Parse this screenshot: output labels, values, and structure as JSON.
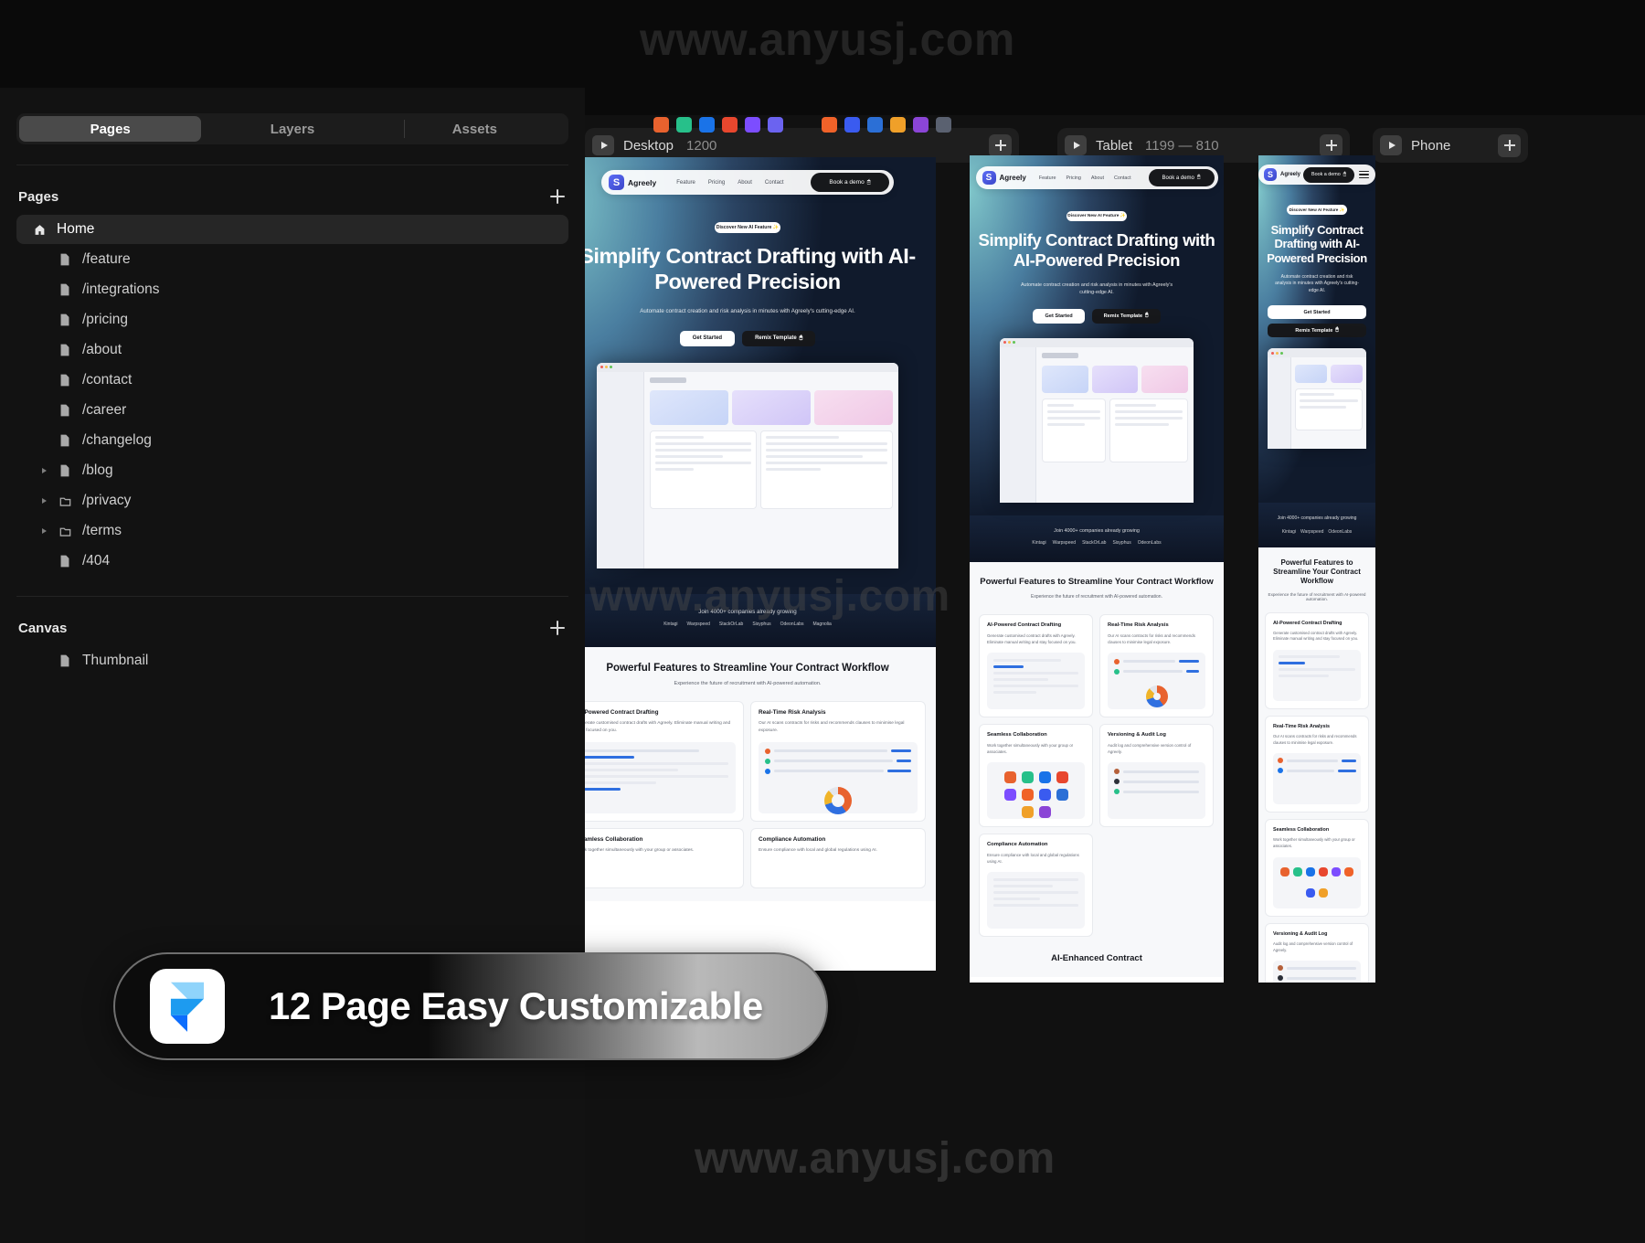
{
  "watermark": {
    "text": "www.anyusj.com"
  },
  "sidebar": {
    "tabs": [
      {
        "label": "Pages",
        "active": true
      },
      {
        "label": "Layers",
        "active": false
      },
      {
        "label": "Assets",
        "active": false
      }
    ],
    "pages_section": {
      "title": "Pages",
      "add_label": "+"
    },
    "pages": [
      {
        "label": "Home",
        "icon": "home-icon",
        "active": true,
        "expandable": false
      },
      {
        "label": "/feature",
        "icon": "page-icon",
        "active": false,
        "expandable": false
      },
      {
        "label": "/integrations",
        "icon": "page-icon",
        "active": false,
        "expandable": false
      },
      {
        "label": "/pricing",
        "icon": "page-icon",
        "active": false,
        "expandable": false
      },
      {
        "label": "/about",
        "icon": "page-icon",
        "active": false,
        "expandable": false
      },
      {
        "label": "/contact",
        "icon": "page-icon",
        "active": false,
        "expandable": false
      },
      {
        "label": "/career",
        "icon": "page-icon",
        "active": false,
        "expandable": false
      },
      {
        "label": "/changelog",
        "icon": "page-icon",
        "active": false,
        "expandable": false
      },
      {
        "label": "/blog",
        "icon": "page-icon",
        "active": false,
        "expandable": true
      },
      {
        "label": "/privacy",
        "icon": "folder-icon",
        "active": false,
        "expandable": true
      },
      {
        "label": "/terms",
        "icon": "folder-icon",
        "active": false,
        "expandable": true
      },
      {
        "label": "/404",
        "icon": "page-icon",
        "active": false,
        "expandable": false
      }
    ],
    "canvas_section": {
      "title": "Canvas",
      "add_label": "+"
    },
    "canvas_items": [
      {
        "label": "Thumbnail",
        "icon": "page-icon"
      }
    ]
  },
  "breakpoints": [
    {
      "name": "Desktop",
      "size": "1200"
    },
    {
      "name": "Tablet",
      "size": "1199 — 810"
    },
    {
      "name": "Phone",
      "size": ""
    }
  ],
  "plugin_icons": [
    {
      "name": "plugin-orange-icon",
      "color": "#e8622e"
    },
    {
      "name": "plugin-green-icon",
      "color": "#27c08a"
    },
    {
      "name": "plugin-blue-icon",
      "color": "#1a73e8"
    },
    {
      "name": "plugin-red-icon",
      "color": "#e8472e"
    },
    {
      "name": "plugin-purple-icon",
      "color": "#7c4dff"
    },
    {
      "name": "plugin-violet-icon",
      "color": "#6b63f0"
    },
    {
      "name": "plugin-orange2-icon",
      "color": "#f06229"
    },
    {
      "name": "plugin-indigo-icon",
      "color": "#3a5bf0"
    },
    {
      "name": "plugin-blue2-icon",
      "color": "#2b6fd6"
    },
    {
      "name": "plugin-amber-icon",
      "color": "#f0a029"
    },
    {
      "name": "plugin-magenta-icon",
      "color": "#8b45d6"
    },
    {
      "name": "plugin-slate-icon",
      "color": "#5a6170"
    }
  ],
  "site": {
    "brand": {
      "initial": "S",
      "name": "Agreely"
    },
    "nav_links": [
      "Feature",
      "Pricing",
      "About",
      "Contact"
    ],
    "nav_cta": "Book a demo",
    "hero_badge": "Discover New AI Feature ✨",
    "hero_title_desktop": "Simplify Contract Drafting with AI-Powered Precision",
    "hero_title_tablet": "Simplify Contract Drafting with AI-Powered Precision",
    "hero_title_phone": "Simplify Contract Drafting with AI-Powered Precision",
    "hero_sub": "Automate contract creation and risk analysis in minutes with Agreely's cutting-edge AI.",
    "cta_primary": "Get Started",
    "cta_secondary": "Remix Template",
    "social_proof": "Join 4000+ companies already growing",
    "logo_row": [
      "Kintagi",
      "Warpspeed",
      "StackOrLab",
      "Sisyphus",
      "OdeonLabs",
      "Magnolia"
    ],
    "features_title": "Powerful Features to Streamline Your Contract Workflow",
    "features_sub": "Experience the future of recruitment with AI-powered automation.",
    "features": [
      {
        "title": "AI-Powered Contract Drafting",
        "desc": "Generate customised contract drafts with Agreely. Eliminate manual writing and stay focused on you.",
        "art": "editor"
      },
      {
        "title": "Real-Time Risk Analysis",
        "desc": "Our AI scans contracts for risks and recommends clauses to minimise legal exposure.",
        "art": "chart"
      },
      {
        "title": "Seamless Collaboration",
        "desc": "Work together simultaneously with your group or associates.",
        "art": "icons"
      },
      {
        "title": "Versioning & Audit Log",
        "desc": "Audit log and comprehensive version control of Agreely.",
        "art": "audit"
      },
      {
        "title": "Compliance Automation",
        "desc": "Ensure compliance with local and global regulations using AI.",
        "art": "table"
      }
    ],
    "section_ai_enhanced": "AI-Enhanced Contract"
  },
  "promo": {
    "title": "12 Page Easy Customizable",
    "logo": "framer-logo"
  }
}
